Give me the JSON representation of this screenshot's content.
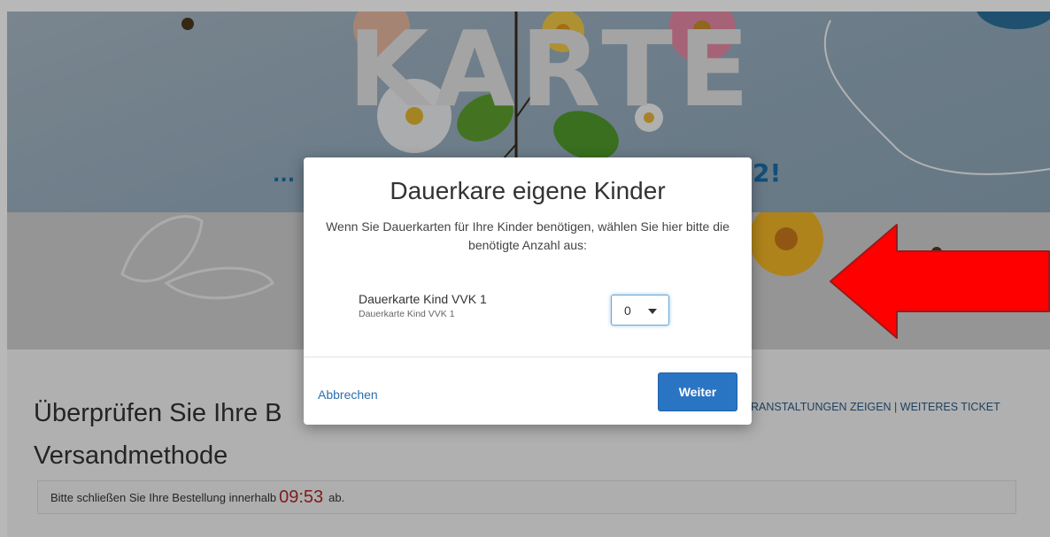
{
  "hero": {
    "title": "KARTE",
    "subtitle_left": "...",
    "subtitle_right": "2!"
  },
  "content": {
    "heading_line1": "Überprüfen Sie Ihre B",
    "heading_line2": "Versandmethode",
    "top_links": "RANSTALTUNGEN ZEIGEN | WEITERES TICKET",
    "notice_before": "Bitte schließen Sie Ihre Bestellung innerhalb",
    "timer": "09:53",
    "notice_after": "ab."
  },
  "modal": {
    "title": "Dauerkare eigene Kinder",
    "description": "Wenn Sie Dauerkarten für Ihre Kinder benötigen, wählen Sie hier bitte die benötigte Anzahl aus:",
    "item_name": "Dauerkarte Kind VVK 1",
    "item_sub": "Dauerkarte Kind VVK 1",
    "quantity": "0",
    "cancel_label": "Abbrechen",
    "continue_label": "Weiter"
  },
  "colors": {
    "accent_blue": "#2a74c4",
    "link_blue": "#2f6fab",
    "timer_red": "#b0262c",
    "arrow_red": "#ff0000",
    "hero_blue": "#1a6ea8"
  },
  "icons": {
    "dropdown": "caret-down-icon",
    "annotation": "red-arrow-left"
  }
}
